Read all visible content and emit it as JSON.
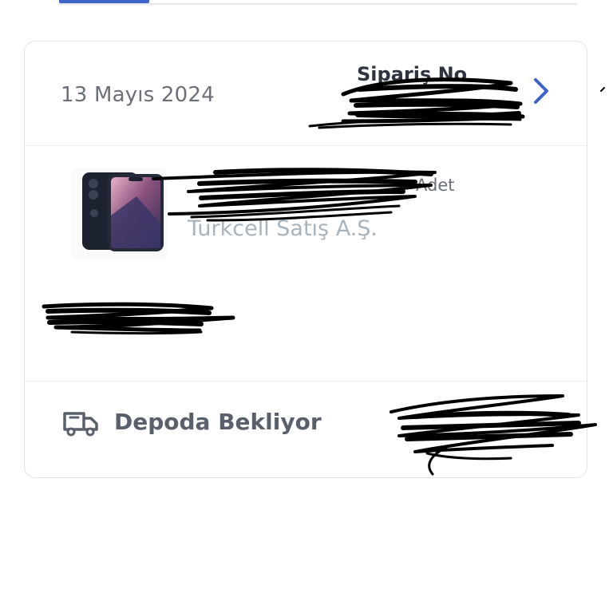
{
  "order": {
    "date": "13 Mayıs 2024",
    "order_no_label": "Sipariş No",
    "order_no_value": ""
  },
  "product": {
    "name": "",
    "quantity": "Adet",
    "seller": "Turkcell Satış A.Ş.",
    "price": ""
  },
  "status": {
    "label": "Depoda Bekliyor",
    "detail": ""
  },
  "icons": {
    "chevron": "chevron-right-icon",
    "truck": "truck-icon",
    "product_image": "phone-image"
  },
  "colors": {
    "accent": "#3d63c9",
    "text_dark": "#2e3440",
    "text_muted": "#6b7078",
    "seller": "#a9b3bb"
  }
}
